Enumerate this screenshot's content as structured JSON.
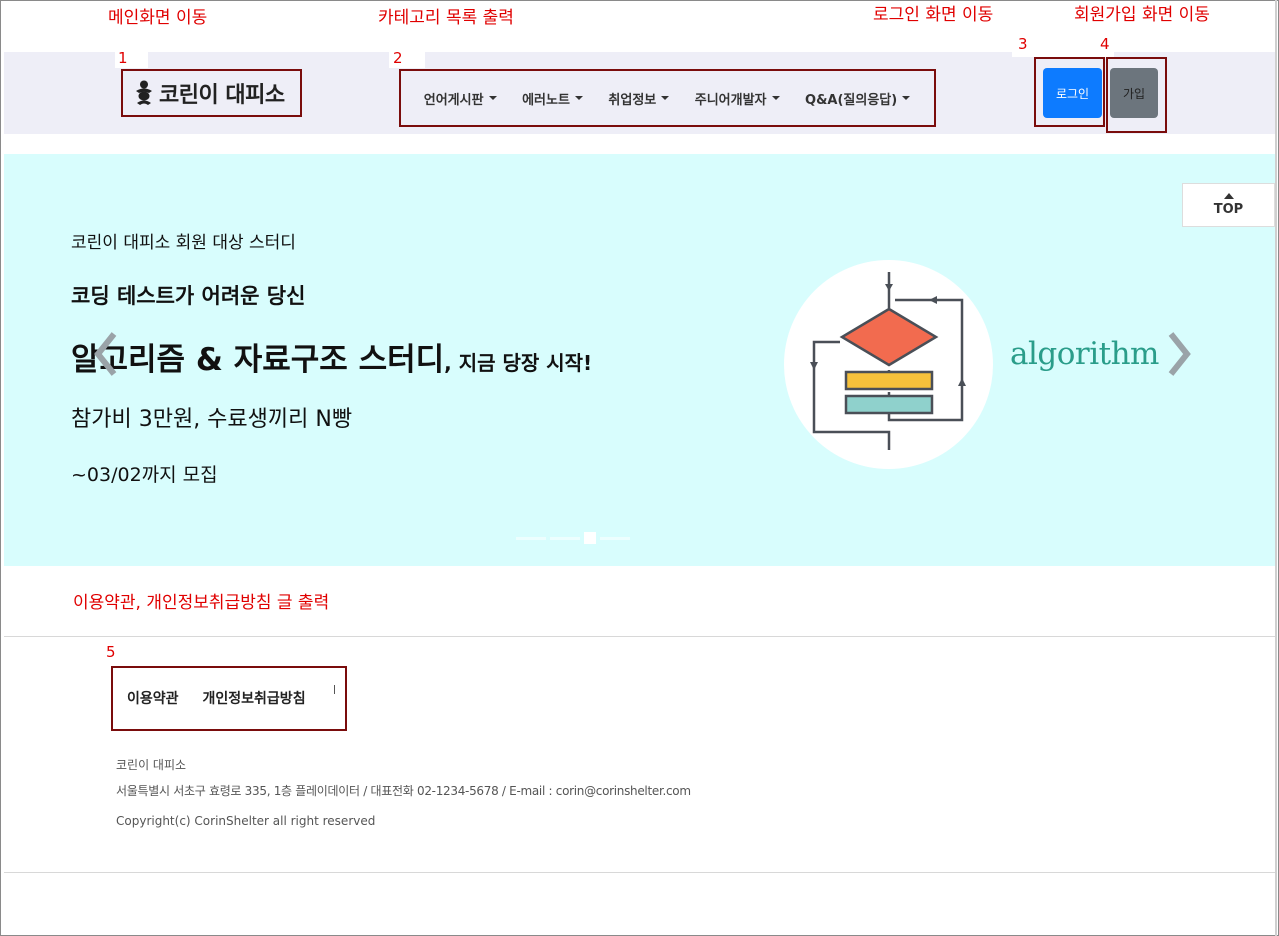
{
  "annotations": {
    "main": "메인화면 이동",
    "category": "카테고리 목록 출력",
    "login": "로그인 화면 이동",
    "signup": "회원가입 화면 이동",
    "terms": "이용약관, 개인정보취급방침 글 출력",
    "n1": "1",
    "n2": "2",
    "n3": "3",
    "n4": "4",
    "n5": "5"
  },
  "header": {
    "logo_text": "코린이 대피소",
    "logo_icon": "baby-icon",
    "nav": [
      {
        "label": "언어게시판"
      },
      {
        "label": "에러노트"
      },
      {
        "label": "취업정보"
      },
      {
        "label": "주니어개발자"
      },
      {
        "label": "Q&A(질의응답)"
      }
    ],
    "login_label": "로그인",
    "join_label": "가입"
  },
  "banner": {
    "small": "코린이 대피소 회원 대상 스터디",
    "headline": "코딩 테스트가 어려운 당신",
    "title_main": "알고리즘 & 자료구조 스터디",
    "title_sub": ", 지금 당장 시작!",
    "fee": "참가비 3만원, 수료생끼리 N빵",
    "deadline": "~03/02까지 모집",
    "image_word": "algorithm",
    "top_label": "TOP",
    "colors": {
      "background": "#d8fdfd",
      "diamond": "#f26b4f",
      "bar1": "#f6c13b",
      "bar2": "#8fd1cc",
      "word": "#2a9d8a"
    }
  },
  "footer": {
    "terms_label": "이용약관",
    "privacy_label": "개인정보취급방침",
    "company": "코린이 대피소",
    "address": "서울특별시 서초구 효령로 335, 1층 플레이데이터 / 대표전화 02-1234-5678 / E-mail : corin@corinshelter.com",
    "copyright": "Copyright(c) CorinShelter all right reserved"
  }
}
